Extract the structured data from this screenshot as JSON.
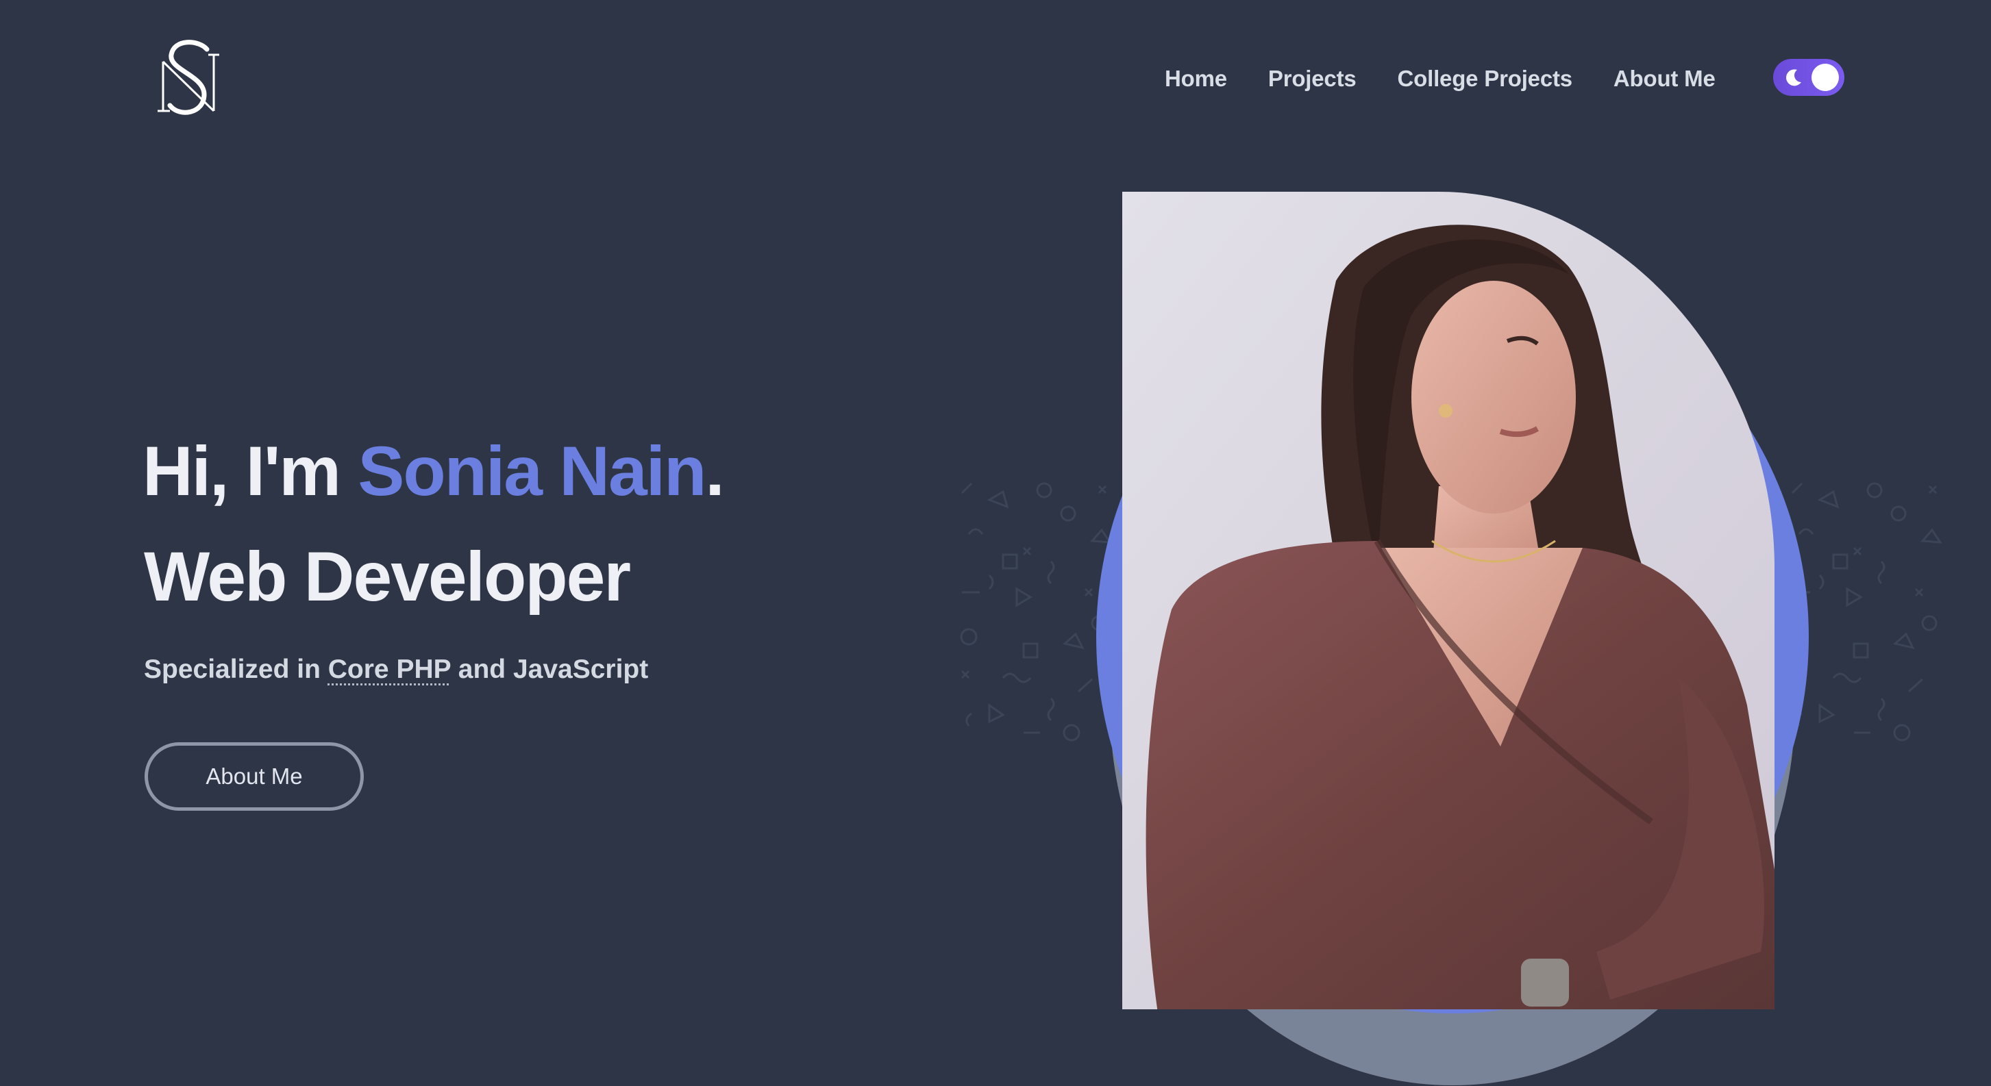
{
  "header": {
    "logo_icon": "monogram-logo",
    "nav": [
      {
        "label": "Home"
      },
      {
        "label": "Projects"
      },
      {
        "label": "College Projects"
      },
      {
        "label": "About Me"
      }
    ],
    "theme_toggle": {
      "icon": "moon-icon",
      "state": "dark"
    }
  },
  "hero": {
    "greeting_prefix": "Hi, I'm ",
    "name": "Sonia Nain",
    "greeting_suffix": ".",
    "role": "Web Developer",
    "specialty_prefix": "Specialized in ",
    "specialty_highlight": "Core PHP",
    "specialty_suffix": " and JavaScript",
    "cta_label": "About Me"
  },
  "portrait": {
    "subject": "profile-photo",
    "accent_color": "#6b7fe0",
    "shadow_color": "#7a8499"
  },
  "colors": {
    "background": "#2e3546",
    "accent": "#6b7fe0",
    "text": "#eef0f5",
    "toggle": "#7b5cf0"
  }
}
